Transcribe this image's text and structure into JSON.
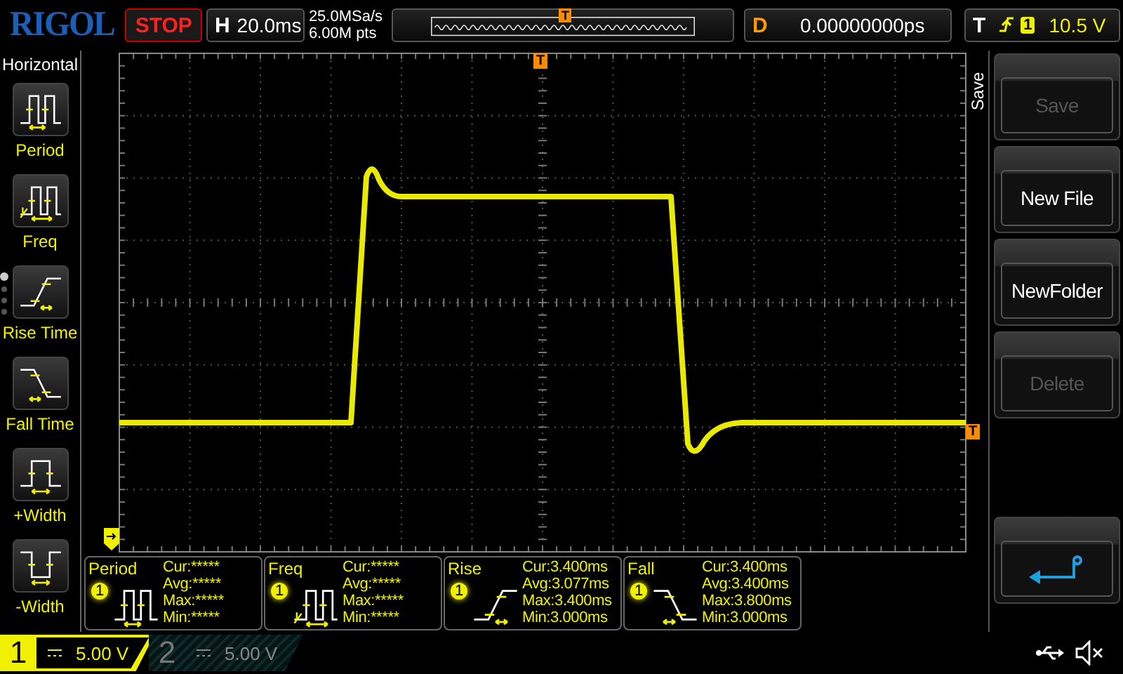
{
  "top_bar": {
    "logo": "RIGOL",
    "run_button": "STOP",
    "horizontal": {
      "label": "H",
      "timebase": "20.0ms"
    },
    "acquisition": {
      "sample_rate": "25.0MSa/s",
      "memory_depth": "6.00M pts"
    },
    "overview": {
      "trigger_marker": "T"
    },
    "delay": {
      "label": "D",
      "value": "0.00000000ps"
    },
    "trigger": {
      "label": "T",
      "source": "1",
      "trigger_level": "10.5 V"
    }
  },
  "left_menu": {
    "title": "Horizontal",
    "items": [
      {
        "label": "Period",
        "kind": "period"
      },
      {
        "label": "Freq",
        "kind": "freq"
      },
      {
        "label": "Rise Time",
        "kind": "rise"
      },
      {
        "label": "Fall Time",
        "kind": "fall"
      },
      {
        "label": "+Width",
        "kind": "pwidth"
      },
      {
        "label": "-Width",
        "kind": "nwidth"
      }
    ],
    "pages": [
      {
        "selected": true
      },
      {
        "selected": false
      },
      {
        "selected": false
      },
      {
        "selected": false
      }
    ]
  },
  "graticule": {
    "trigger_position_marker": "T",
    "trigger_level_marker": "T"
  },
  "measurements": [
    {
      "name": "Period",
      "channel": "1",
      "kind": "period",
      "rows": [
        "Cur:*****",
        "Avg:*****",
        "Max:*****",
        "Min:*****"
      ]
    },
    {
      "name": "Freq",
      "channel": "1",
      "kind": "freq",
      "rows": [
        "Cur:*****",
        "Avg:*****",
        "Max:*****",
        "Min:*****"
      ]
    },
    {
      "name": "Rise",
      "channel": "1",
      "kind": "rise",
      "rows": [
        "Cur:3.400ms",
        "Avg:3.077ms",
        "Max:3.400ms",
        "Min:3.000ms"
      ]
    },
    {
      "name": "Fall",
      "channel": "1",
      "kind": "fall",
      "rows": [
        "Cur:3.400ms",
        "Avg:3.400ms",
        "Max:3.800ms",
        "Min:3.000ms"
      ]
    }
  ],
  "channels": [
    {
      "number": "1",
      "scale": "5.00 V",
      "on": true
    },
    {
      "number": "2",
      "scale": "5.00 V",
      "on": false
    }
  ],
  "right_menu": {
    "title": "Save",
    "buttons": [
      {
        "kind": "text",
        "label": "Save",
        "disabled": true
      },
      {
        "kind": "text",
        "label": "New File",
        "disabled": false
      },
      {
        "kind": "text",
        "label": "NewFolder",
        "disabled": false
      },
      {
        "kind": "text",
        "label": "Delete",
        "disabled": true
      },
      {
        "kind": "spacer"
      },
      {
        "kind": "return"
      }
    ]
  }
}
